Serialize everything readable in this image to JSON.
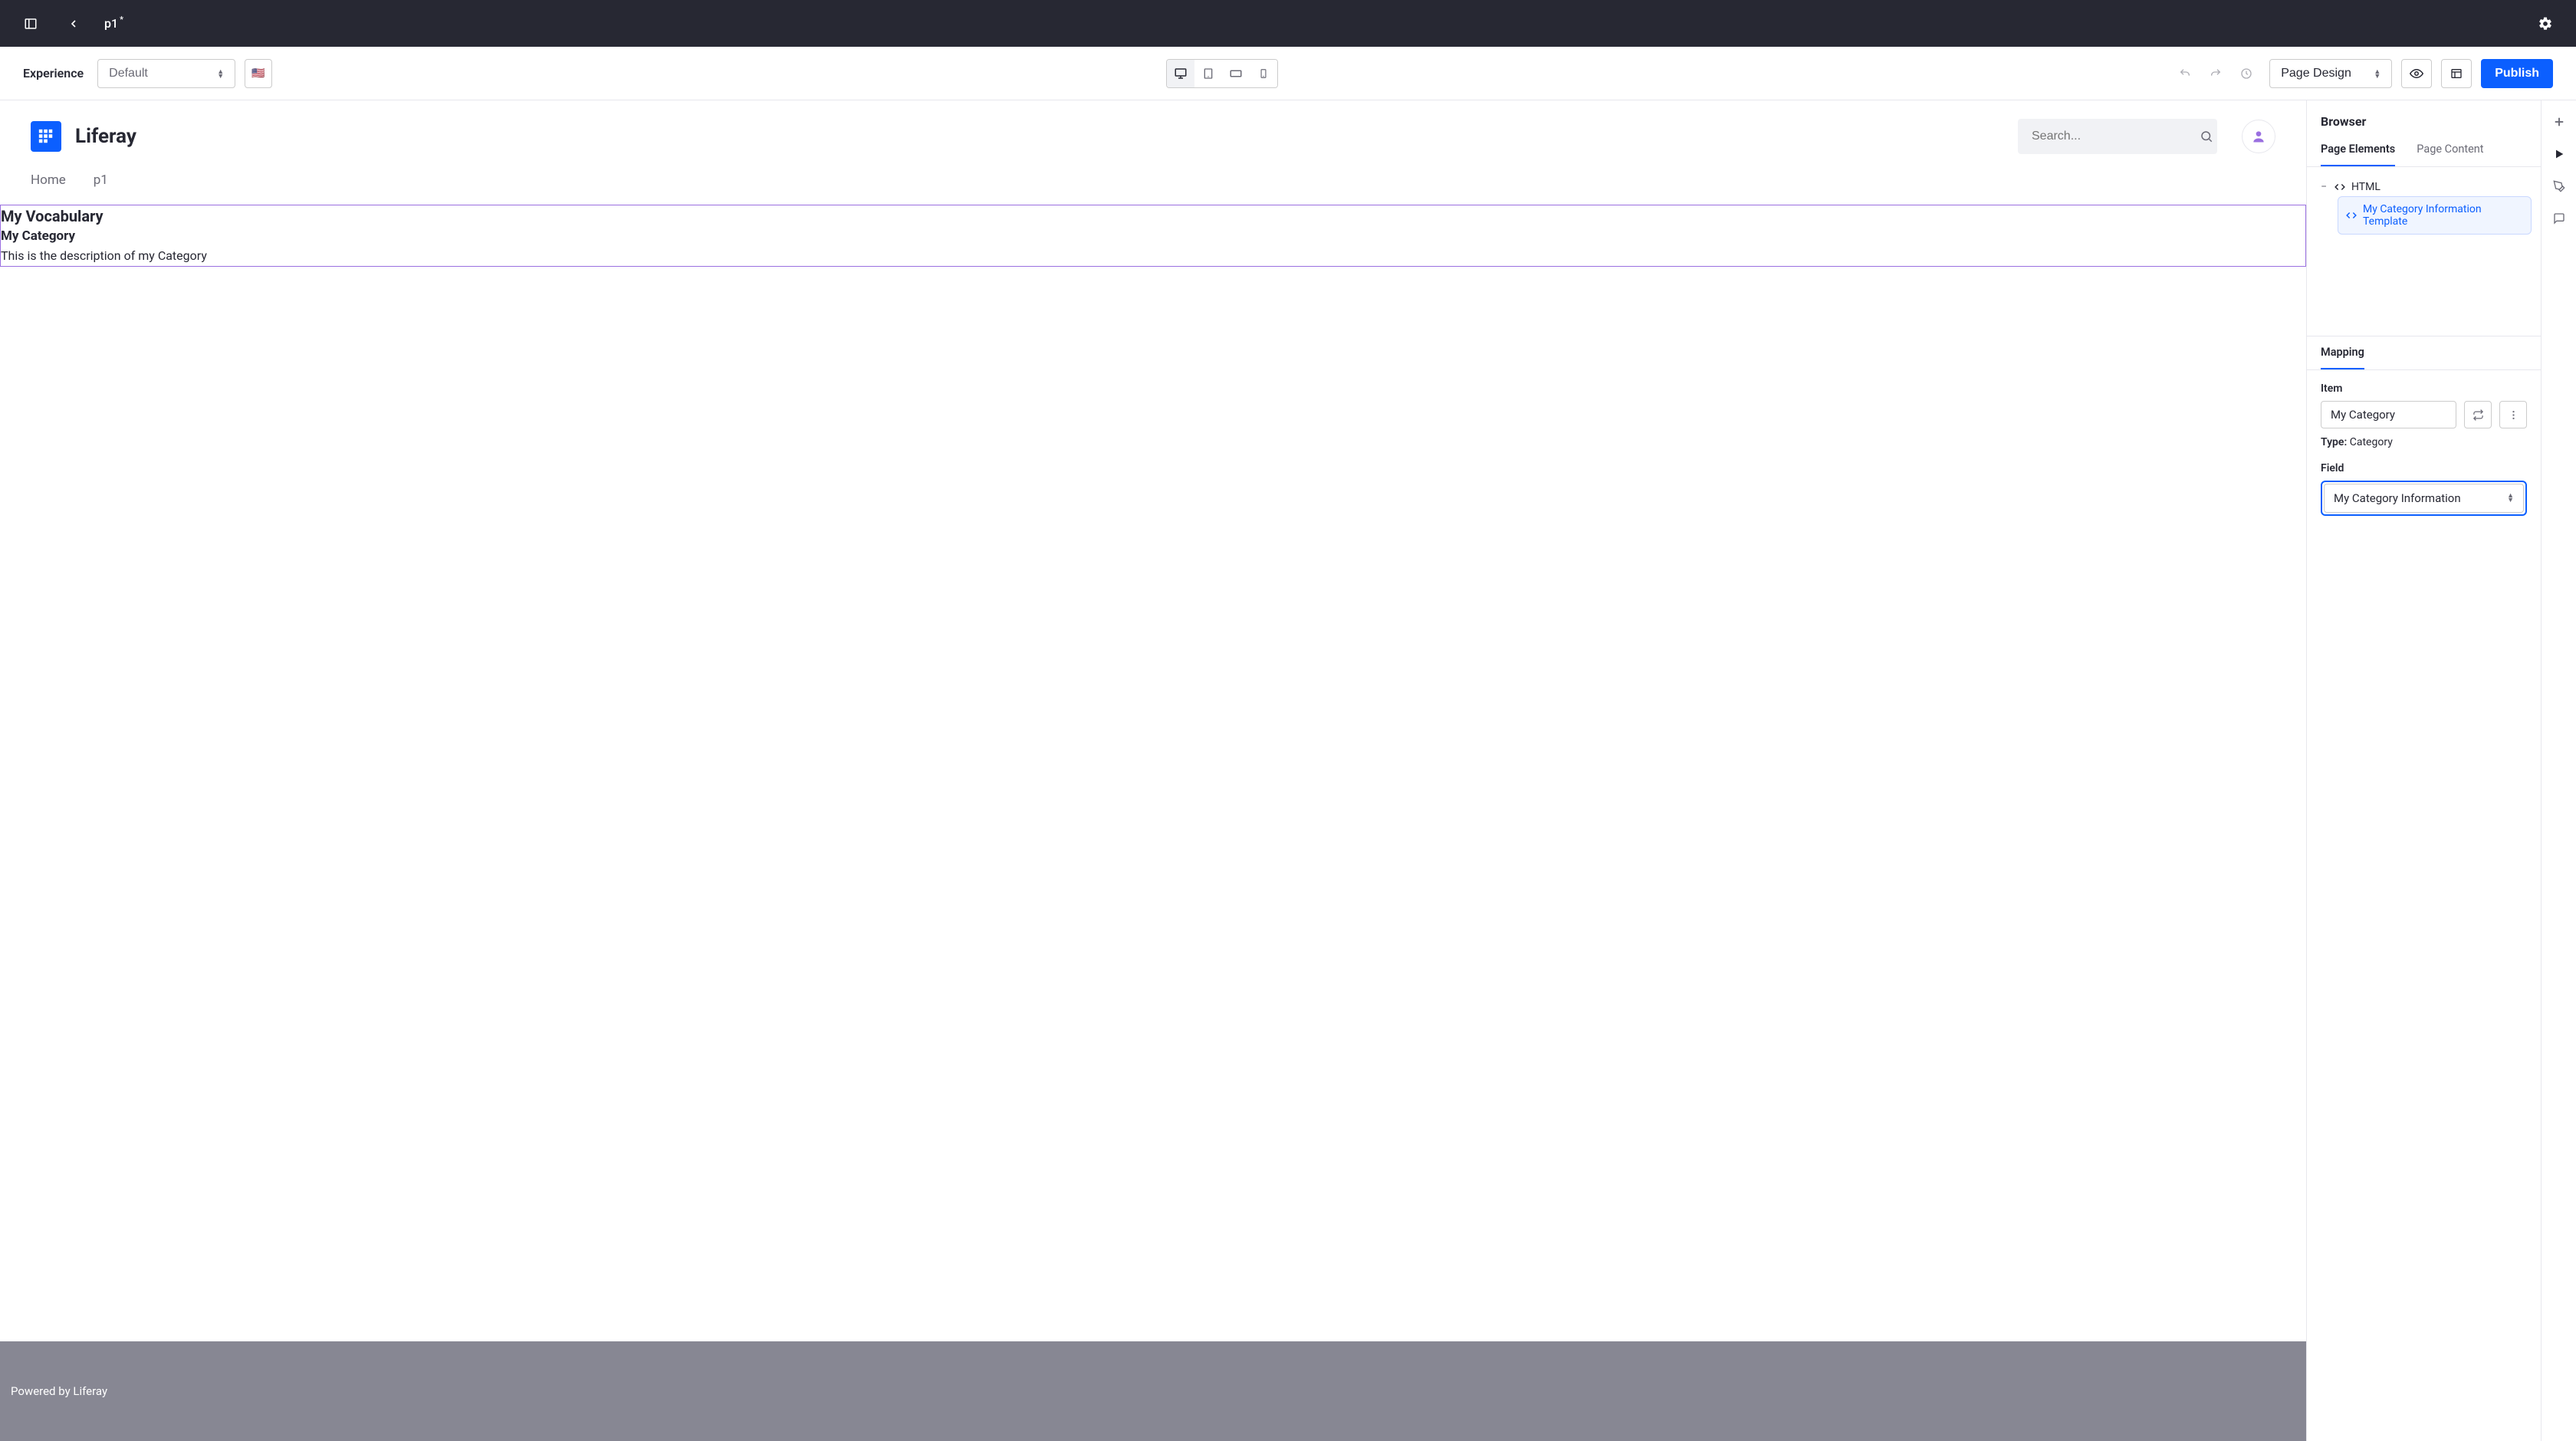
{
  "topbar": {
    "page_name": "p1",
    "modified": "*"
  },
  "toolbar": {
    "experience_label": "Experience",
    "experience_value": "Default",
    "mode_value": "Page Design",
    "publish_label": "Publish"
  },
  "site": {
    "name": "Liferay",
    "search_placeholder": "Search...",
    "nav_home": "Home",
    "nav_p1": "p1",
    "footer": "Powered by Liferay"
  },
  "fragment": {
    "title": "My Vocabulary",
    "subtitle": "My Category",
    "description": "This is the description of my Category"
  },
  "browser": {
    "title": "Browser",
    "tab_elements": "Page Elements",
    "tab_content": "Page Content",
    "tree_root": "HTML",
    "tree_child": "My Category Information Template"
  },
  "mapping": {
    "tab": "Mapping",
    "item_label": "Item",
    "item_value": "My Category",
    "type_key": "Type:",
    "type_value": "Category",
    "field_label": "Field",
    "field_value": "My Category Information"
  }
}
